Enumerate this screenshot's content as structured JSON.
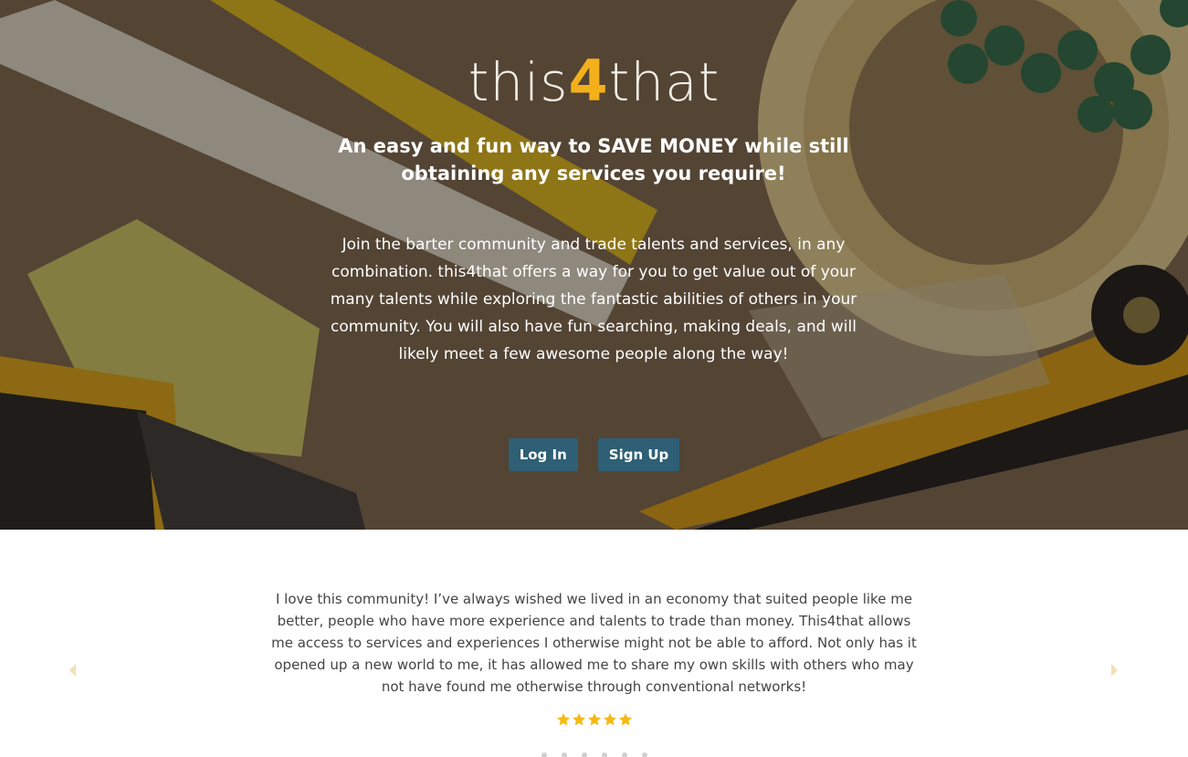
{
  "hero": {
    "logo_prefix": "this",
    "logo_four": "4",
    "logo_suffix": "that",
    "tagline": "An easy and fun way to SAVE MONEY while still obtaining any services you require!",
    "intro": "Join the barter community and trade talents and services, in any combination. this4that offers a way for you to get value out of your many talents while exploring the fantastic abilities of others in your community. You will also have fun searching, making deals, and will likely meet a few awesome people along the way!",
    "login_label": "Log In",
    "signup_label": "Sign Up"
  },
  "testimonial": {
    "quote": "I love this community! I’ve always wished we lived in an economy that suited people like me better, people who have more experience and talents to trade than money. This4that allows me access to services and experiences I otherwise might not be able to afford. Not only has it opened up a new world to me, it has allowed me to share my own skills with others who may not have found me otherwise through conventional networks!",
    "rating": 5,
    "rating_max": 5,
    "slide_count": 6
  },
  "colors": {
    "brand_gold": "#f3b01a",
    "button": "#2e5f74",
    "star": "#f5b916",
    "arrow": "#f0e2b4"
  },
  "icons": {
    "prev": "caret-left-icon",
    "next": "caret-right-icon",
    "rating": "star-icon"
  }
}
